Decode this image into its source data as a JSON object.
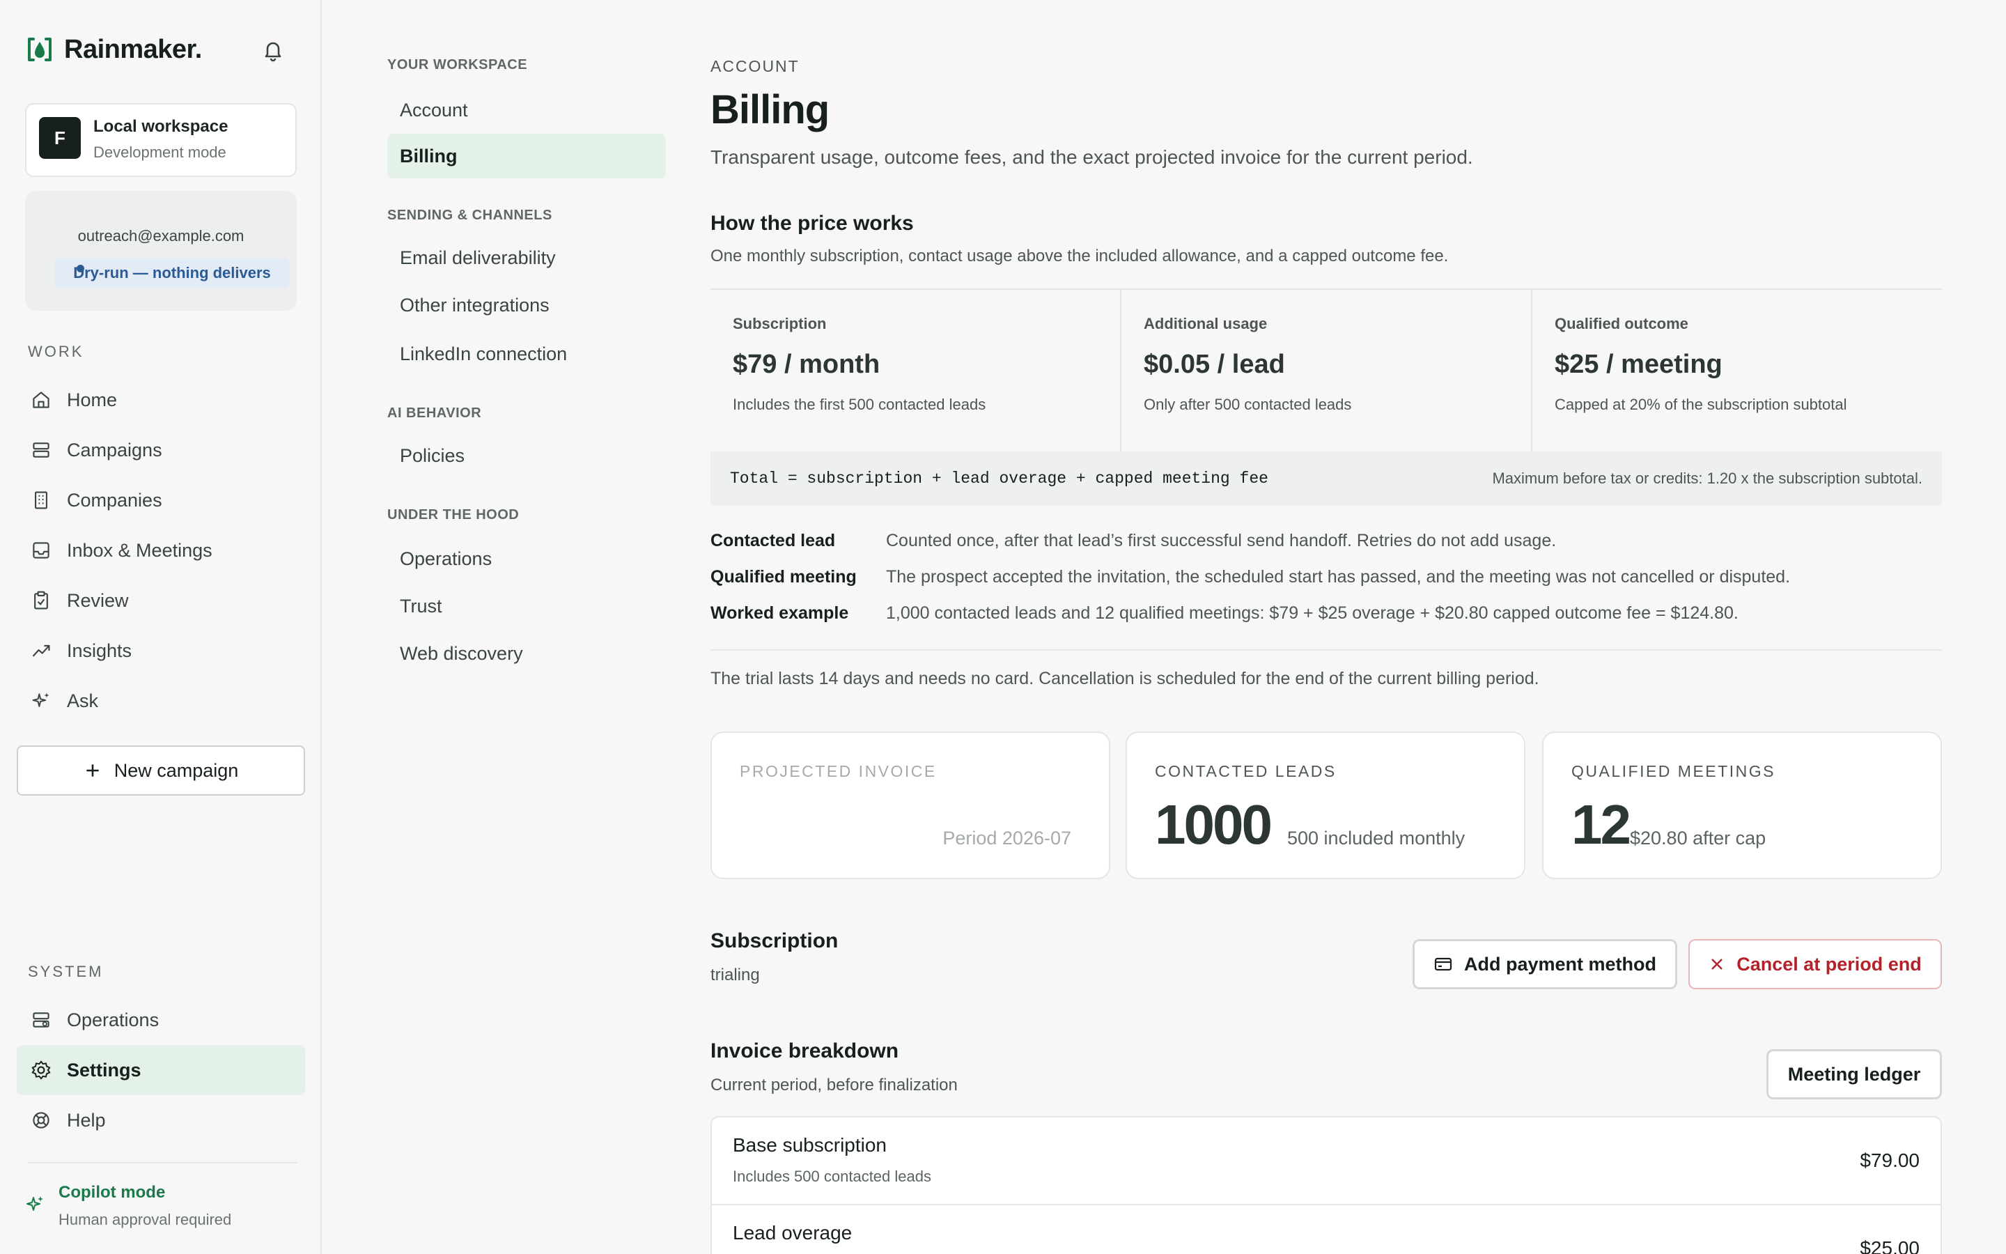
{
  "brand": {
    "name": "Rainmaker."
  },
  "workspace": {
    "avatar": "F",
    "name": "Local workspace",
    "mode": "Development mode"
  },
  "sender": {
    "email": "outreach@example.com",
    "status": "Dry-run — nothing delivers"
  },
  "nav": {
    "work_label": "WORK",
    "work_items": [
      {
        "label": "Home",
        "icon": "home-icon"
      },
      {
        "label": "Campaigns",
        "icon": "layers-icon"
      },
      {
        "label": "Companies",
        "icon": "building-icon"
      },
      {
        "label": "Inbox & Meetings",
        "icon": "inbox-icon"
      },
      {
        "label": "Review",
        "icon": "clipboard-check-icon"
      },
      {
        "label": "Insights",
        "icon": "trending-up-icon"
      },
      {
        "label": "Ask",
        "icon": "sparkles-icon"
      }
    ],
    "new_campaign": "New campaign",
    "system_label": "SYSTEM",
    "system_items": [
      {
        "label": "Operations",
        "icon": "server-icon"
      },
      {
        "label": "Settings",
        "icon": "gear-icon",
        "active": true
      },
      {
        "label": "Help",
        "icon": "lifebuoy-icon"
      }
    ]
  },
  "copilot": {
    "title": "Copilot mode",
    "subtitle": "Human approval required"
  },
  "settings_nav": {
    "sections": [
      {
        "label": "YOUR WORKSPACE",
        "items": [
          "Account",
          "Billing"
        ]
      },
      {
        "label": "SENDING & CHANNELS",
        "items": [
          "Email deliverability",
          "Other integrations",
          "LinkedIn connection"
        ]
      },
      {
        "label": "AI BEHAVIOR",
        "items": [
          "Policies"
        ]
      },
      {
        "label": "UNDER THE HOOD",
        "items": [
          "Operations",
          "Trust",
          "Web discovery"
        ]
      }
    ],
    "active": "Billing"
  },
  "page": {
    "eyebrow": "ACCOUNT",
    "title": "Billing",
    "subtitle": "Transparent usage, outcome fees, and the exact projected invoice for the current period."
  },
  "pricing": {
    "title": "How the price works",
    "subtitle": "One monthly subscription, contact usage above the included allowance, and a capped outcome fee.",
    "columns": [
      {
        "label": "Subscription",
        "value": "$79 / month",
        "note": "Includes the first 500 contacted leads"
      },
      {
        "label": "Additional usage",
        "value": "$0.05 / lead",
        "note": "Only after 500 contacted leads"
      },
      {
        "label": "Qualified outcome",
        "value": "$25 / meeting",
        "note": "Capped at 20% of the subscription subtotal"
      }
    ],
    "formula": "Total = subscription + lead overage + capped meeting fee",
    "formula_note": "Maximum before tax or credits: 1.20 x the subscription subtotal.",
    "definitions": [
      {
        "term": "Contacted lead",
        "desc": "Counted once, after that lead’s first successful send handoff. Retries do not add usage."
      },
      {
        "term": "Qualified meeting",
        "desc": "The prospect accepted the invitation, the scheduled start has passed, and the meeting was not cancelled or disputed."
      },
      {
        "term": "Worked example",
        "desc": "1,000 contacted leads and 12 qualified meetings: $79 + $25 overage + $20.80 capped outcome fee = $124.80."
      }
    ],
    "trial_note": "The trial lasts 14 days and needs no card. Cancellation is scheduled for the end of the current billing period."
  },
  "stats": {
    "projected": {
      "label": "PROJECTED INVOICE",
      "period": "Period 2026-07"
    },
    "leads": {
      "label": "CONTACTED LEADS",
      "value": "1000",
      "note": "500 included monthly"
    },
    "meetings": {
      "label": "QUALIFIED MEETINGS",
      "value": "12",
      "note": "$20.80 after cap"
    }
  },
  "subscription": {
    "title": "Subscription",
    "status": "trialing",
    "add_payment": "Add payment method",
    "cancel": "Cancel at period end"
  },
  "invoice": {
    "title": "Invoice breakdown",
    "subtitle": "Current period, before finalization",
    "ledger_button": "Meeting ledger",
    "rows": [
      {
        "name": "Base subscription",
        "desc": "Includes 500 contacted leads",
        "amount": "$79.00"
      },
      {
        "name": "Lead overage",
        "desc": "",
        "amount": "$25.00"
      }
    ]
  },
  "colors": {
    "accent_green": "#1a7a4a",
    "active_bg": "#e3f1e8",
    "danger": "#b3222a",
    "info": "#2a5b96"
  }
}
